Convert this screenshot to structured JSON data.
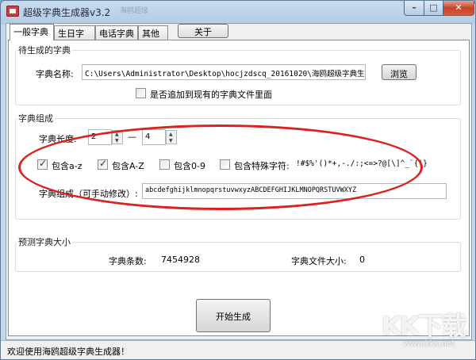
{
  "window": {
    "title": "超级字典生成器v3.2",
    "title_smudge": "海鸥超级"
  },
  "tabs": [
    {
      "label": "一般字典"
    },
    {
      "label": "生日字典"
    },
    {
      "label": "电话字典"
    },
    {
      "label": "其他"
    }
  ],
  "about_button": "关于",
  "pending_group": {
    "title": "待生成的字典",
    "name_label": "字典名称:",
    "name_value": "C:\\Users\\Administrator\\Desktop\\hocjzdscq_20161020\\海鸥超级字典生成",
    "browse_button": "浏览",
    "append_checkbox_label": "是否追加到现有的字典文件里面",
    "append_checked": false
  },
  "composition_group": {
    "title": "字典组成",
    "length_label": "字典长度:",
    "length_min": "2",
    "dash": "—",
    "length_max": "4",
    "options": [
      {
        "label": "包含a-z",
        "checked": true
      },
      {
        "label": "包含A-Z",
        "checked": true
      },
      {
        "label": "包含0-9",
        "checked": false
      },
      {
        "label": "包含特殊字符:",
        "checked": false
      }
    ],
    "special_chars": "!#$%'()*+,-./:;<=>?@[\\]^_`{|}",
    "charset_label": "字典组成（可手动修改）:",
    "charset_value": "abcdefghijklmnopqrstuvwxyzABCDEFGHIJKLMNOPQRSTUVWXYZ"
  },
  "estimate_group": {
    "title": "预测字典大小",
    "count_label": "字典条数:",
    "count_value": "7454928",
    "size_label": "字典文件大小:",
    "size_value": "0"
  },
  "start_button": "开始生成",
  "status": {
    "text": "欢迎使用海鸥超级字典生成器！"
  },
  "watermark": {
    "logo": "KK下载",
    "url": "www.kkx.net"
  }
}
